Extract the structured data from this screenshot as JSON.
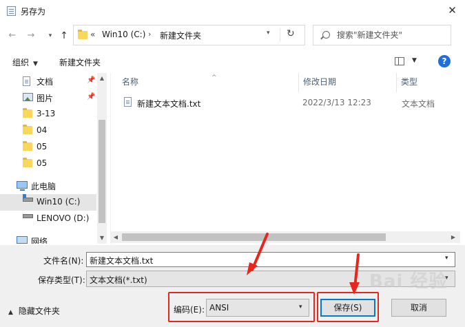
{
  "window": {
    "title": "另存为",
    "close_glyph": "✕"
  },
  "address_bar": {
    "crumb_more": "«",
    "crumbs": [
      "Win10 (C:)",
      "新建文件夹"
    ],
    "separator": "›"
  },
  "search": {
    "placeholder": "搜索\"新建文件夹\""
  },
  "toolbar": {
    "organize_label": "组织",
    "new_folder_label": "新建文件夹",
    "help_glyph": "?"
  },
  "sidebar": {
    "items": [
      {
        "label": "文档",
        "icon": "document-icon",
        "pinned": true
      },
      {
        "label": "图片",
        "icon": "pictures-icon",
        "pinned": true
      },
      {
        "label": "3-13",
        "icon": "folder-icon"
      },
      {
        "label": "04",
        "icon": "folder-icon"
      },
      {
        "label": "05",
        "icon": "folder-icon"
      },
      {
        "label": "05",
        "icon": "folder-icon"
      },
      {
        "label": "此电脑",
        "icon": "this-pc-icon"
      },
      {
        "label": "Win10 (C:)",
        "icon": "drive-icon",
        "selected": true
      },
      {
        "label": "LENOVO (D:)",
        "icon": "drive-icon"
      },
      {
        "label": "网络",
        "icon": "network-icon"
      }
    ]
  },
  "file_list": {
    "columns": [
      "名称",
      "修改日期",
      "类型"
    ],
    "rows": [
      {
        "name": "新建文本文档.txt",
        "modified": "2022/3/13 12:23",
        "type": "文本文档"
      }
    ]
  },
  "form": {
    "filename_label": "文件名(N):",
    "filename_value": "新建文本文档.txt",
    "filetype_label": "保存类型(T):",
    "filetype_value": "文本文档(*.txt)",
    "encoding_label": "编码(E):",
    "encoding_value": "ANSI",
    "hide_folders_label": "隐藏文件夹",
    "save_label": "保存(S)",
    "cancel_label": "取消"
  },
  "watermark": "Bai 经验",
  "colors": {
    "annotation_red": "#e8261b",
    "accent_blue": "#0078d7",
    "folder_yellow": "#f9d65c"
  }
}
